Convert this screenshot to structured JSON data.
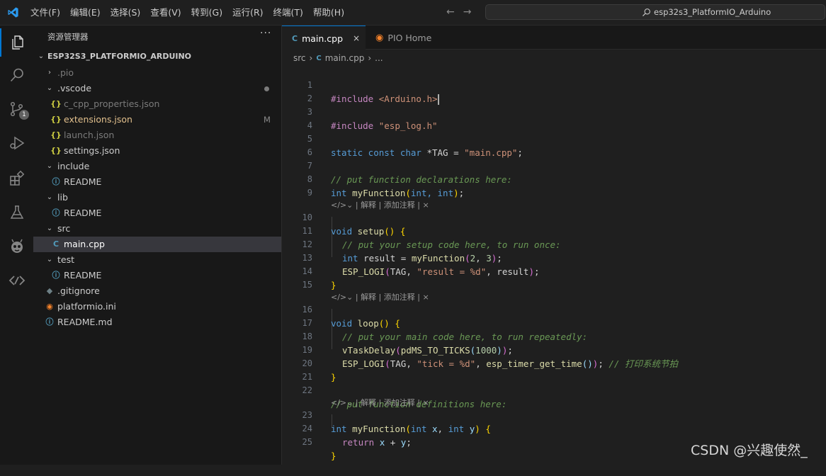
{
  "menu": [
    "文件(F)",
    "编辑(E)",
    "选择(S)",
    "查看(V)",
    "转到(G)",
    "运行(R)",
    "终端(T)",
    "帮助(H)"
  ],
  "command_center": {
    "text": "esp32s3_PlatformIO_Arduino"
  },
  "activity": {
    "source_control_badge": "1"
  },
  "sidebar": {
    "title": "资源管理器",
    "more": "···",
    "root": "ESP32S3_PLATFORMIO_ARDUINO",
    "items": [
      {
        "label": ".pio",
        "decoration": ""
      },
      {
        "label": ".vscode",
        "decoration": ""
      },
      {
        "label": "c_cpp_properties.json",
        "decoration": ""
      },
      {
        "label": "extensions.json",
        "decoration": "M"
      },
      {
        "label": "launch.json",
        "decoration": ""
      },
      {
        "label": "settings.json",
        "decoration": ""
      },
      {
        "label": "include",
        "decoration": ""
      },
      {
        "label": "README",
        "decoration": ""
      },
      {
        "label": "lib",
        "decoration": ""
      },
      {
        "label": "README",
        "decoration": ""
      },
      {
        "label": "src",
        "decoration": ""
      },
      {
        "label": "main.cpp",
        "decoration": ""
      },
      {
        "label": "test",
        "decoration": ""
      },
      {
        "label": "README",
        "decoration": ""
      },
      {
        "label": ".gitignore",
        "decoration": ""
      },
      {
        "label": "platformio.ini",
        "decoration": ""
      },
      {
        "label": "README.md",
        "decoration": ""
      }
    ]
  },
  "tabs": [
    {
      "label": "main.cpp",
      "close": "×"
    },
    {
      "label": "PIO Home"
    }
  ],
  "breadcrumb": {
    "folder": "src",
    "file": "main.cpp",
    "more": "..."
  },
  "editor": {
    "codelens": [
      "解释",
      "添加注释"
    ],
    "line_numbers": [
      "1",
      "2",
      "3",
      "4",
      "5",
      "6",
      "7",
      "8",
      "9",
      "10",
      "11",
      "12",
      "13",
      "14",
      "15",
      "16",
      "17",
      "18",
      "19",
      "20",
      "21",
      "22",
      "23",
      "24",
      "25"
    ],
    "lines": {
      "l1_inc": "#include",
      "l1_hdr": "<Arduino.h>",
      "l3_inc": "#include",
      "l3_hdr": "\"esp_log.h\"",
      "l5_kw": "static const char",
      "l5_rest": " *TAG = ",
      "l5_str": "\"main.cpp\"",
      "l5_end": ";",
      "l7": "// put function declarations here:",
      "l8_kw": "int",
      "l8_fn": "myFunction",
      "l8_args": "int, int",
      "l8_end": ";",
      "l10_kw": "void",
      "l10_fn": "setup",
      "l11": "// put your setup code here, to run once:",
      "l12_kw": "int",
      "l12_var": "result",
      "l12_fn": "myFunction",
      "l12_n1": "2",
      "l12_n2": "3",
      "l13_mac": "ESP_LOGI",
      "l13_tag": "TAG",
      "l13_str": "\"result = %d\"",
      "l13_var": "result",
      "l16_kw": "void",
      "l16_fn": "loop",
      "l17": "// put your main code here, to run repeatedly:",
      "l18_fn": "vTaskDelay",
      "l18_mac": "pdMS_TO_TICKS",
      "l18_num": "1000",
      "l19_mac": "ESP_LOGI",
      "l19_tag": "TAG",
      "l19_str": "\"tick = %d\"",
      "l19_fn": "esp_timer_get_time",
      "l19_cm": "// 打印系统节拍",
      "l22": "// put function definitions here:",
      "l23_kw": "int",
      "l23_fn": "myFunction",
      "l23_kw2": "int",
      "l23_x": "x",
      "l23_kw3": "int",
      "l23_y": "y",
      "l24_kw": "return",
      "l24_x": "x",
      "l24_op": " + ",
      "l24_y": "y"
    }
  },
  "watermark": "CSDN @兴趣使然_"
}
